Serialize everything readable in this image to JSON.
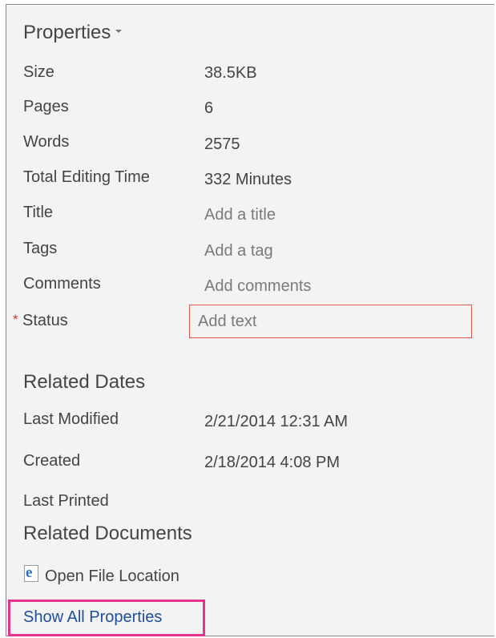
{
  "properties": {
    "heading": "Properties",
    "rows": [
      {
        "label": "Size",
        "value": "38.5KB"
      },
      {
        "label": "Pages",
        "value": "6"
      },
      {
        "label": "Words",
        "value": "2575"
      },
      {
        "label": "Total Editing Time",
        "value": "332 Minutes"
      }
    ],
    "editable": [
      {
        "label": "Title",
        "placeholder": "Add a title"
      },
      {
        "label": "Tags",
        "placeholder": "Add a tag"
      },
      {
        "label": "Comments",
        "placeholder": "Add comments"
      }
    ],
    "status": {
      "required_mark": "*",
      "label": "Status",
      "placeholder": "Add text"
    }
  },
  "related_dates": {
    "heading": "Related Dates",
    "rows": [
      {
        "label": "Last Modified",
        "value": "2/21/2014 12:31 AM"
      },
      {
        "label": "Created",
        "value": "2/18/2014 4:08 PM"
      },
      {
        "label": "Last Printed",
        "value": ""
      }
    ]
  },
  "related_documents": {
    "heading": "Related Documents",
    "open_file_location": {
      "icon": "ie-file-icon",
      "label": "Open File Location"
    }
  },
  "show_all_properties": {
    "label": "Show All Properties"
  },
  "colors": {
    "panel_background": "#f3f3f3",
    "status_border": "#e05a4c",
    "required_star": "#d13438",
    "link": "#1e4e9c",
    "highlight": "#e4338c"
  }
}
